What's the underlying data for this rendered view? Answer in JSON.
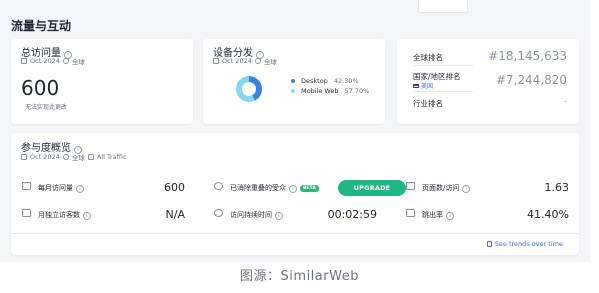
{
  "section": {
    "title": "流量与互动"
  },
  "total_visits": {
    "title": "总访问量",
    "date": "Oct 2024",
    "region": "全球",
    "value": "600",
    "note": "无法实现此更改"
  },
  "device_distribution": {
    "title": "设备分发",
    "date": "Oct 2024",
    "region": "全球",
    "slices": [
      {
        "label": "Desktop",
        "percent": 42.3,
        "percent_text": "42.30%",
        "color": "#3b82e6"
      },
      {
        "label": "Mobile Web",
        "percent": 57.7,
        "percent_text": "57.70%",
        "color": "#86d6f2"
      }
    ]
  },
  "rankings": {
    "global_label": "全球排名",
    "global_value": "#18,145,633",
    "country_label": "国家/地区排名",
    "country_value": "#7,244,820",
    "country_link": "美国",
    "category_label": "行业排名",
    "category_value": "-"
  },
  "engagement": {
    "title": "参与度概览",
    "date": "Oct 2024",
    "region": "全球",
    "traffic": "All Traffic",
    "monthly_visits_label": "每月访问量",
    "monthly_visits_value": "600",
    "unique_visitors_label": "月独立访客数",
    "unique_visitors_value": "N/A",
    "dedup_label": "已消除重叠的受众",
    "beta_badge": "BETA",
    "upgrade_label": "UPGRADE",
    "duration_label": "访问持续时间",
    "duration_value": "00:02:59",
    "pages_label": "页面数/访问",
    "pages_value": "1.63",
    "bounce_label": "跳出率",
    "bounce_value": "41.40%",
    "trends_link": "See trends over time"
  },
  "caption": "图源：SimilarWeb"
}
